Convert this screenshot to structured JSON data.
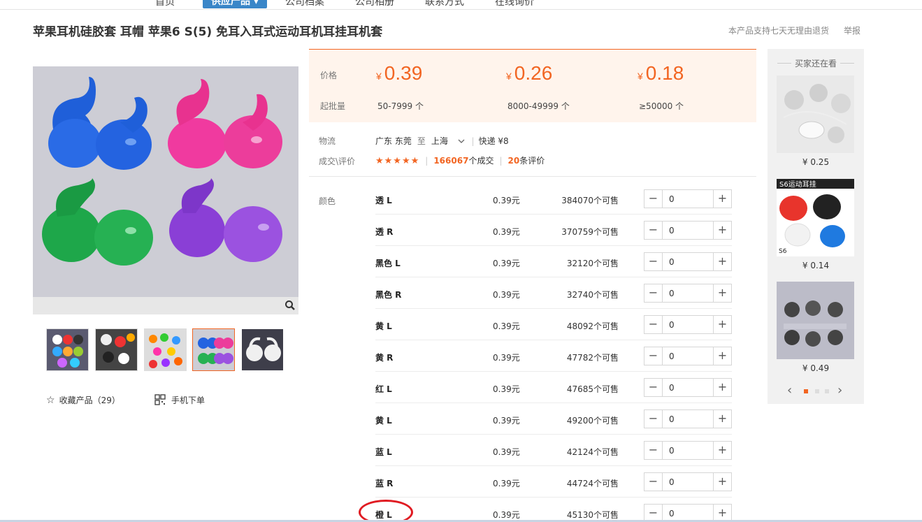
{
  "nav": {
    "items": [
      "首页",
      "供应产品 ▾",
      "公司档案",
      "公司相册",
      "联系方式",
      "在线询价"
    ]
  },
  "product": {
    "title": "苹果耳机硅胶套 耳帽 苹果6 S(5) 免耳入耳式运动耳机耳挂耳机套",
    "return_policy": "本产品支持七天无理由退货",
    "report": "举报"
  },
  "gallery": {
    "favorite_label": "收藏产品（29）",
    "mobile_label": "手机下单"
  },
  "pricing": {
    "price_label": "价格",
    "qty_label": "起批量",
    "currency": "¥",
    "tiers": [
      {
        "price": "0.39",
        "qty": "50-7999 个"
      },
      {
        "price": "0.26",
        "qty": "8000-49999 个"
      },
      {
        "price": "0.18",
        "qty": "≥50000 个"
      }
    ]
  },
  "logistics": {
    "label": "物流",
    "from": "广东 东莞",
    "to_word": "至",
    "to": "上海",
    "express": "快递 ¥8"
  },
  "deals": {
    "label": "成交\\评价",
    "stars": "★★★★★",
    "deal_count": "166067",
    "deal_suffix": "个成交",
    "review_count": "20",
    "review_suffix": "条评价"
  },
  "sku": {
    "label": "颜色",
    "rows": [
      {
        "name": "透 L",
        "price": "0.39元",
        "stock": "384070个可售",
        "qty": "0"
      },
      {
        "name": "透 R",
        "price": "0.39元",
        "stock": "370759个可售",
        "qty": "0"
      },
      {
        "name": "黑色 L",
        "price": "0.39元",
        "stock": "32120个可售",
        "qty": "0"
      },
      {
        "name": "黑色 R",
        "price": "0.39元",
        "stock": "32740个可售",
        "qty": "0"
      },
      {
        "name": "黄 L",
        "price": "0.39元",
        "stock": "48092个可售",
        "qty": "0"
      },
      {
        "name": "黄 R",
        "price": "0.39元",
        "stock": "47782个可售",
        "qty": "0"
      },
      {
        "name": "红 L",
        "price": "0.39元",
        "stock": "47685个可售",
        "qty": "0"
      },
      {
        "name": "黄 L",
        "price": "0.39元",
        "stock": "49200个可售",
        "qty": "0"
      },
      {
        "name": "蓝 L",
        "price": "0.39元",
        "stock": "42124个可售",
        "qty": "0"
      },
      {
        "name": "蓝 R",
        "price": "0.39元",
        "stock": "44724个可售",
        "qty": "0"
      },
      {
        "name": "橙 L",
        "price": "0.39元",
        "stock": "45130个可售",
        "qty": "0"
      }
    ]
  },
  "side": {
    "title": "买家还在看",
    "items": [
      {
        "price": "¥ 0.25"
      },
      {
        "price": "¥ 0.14",
        "image_text": "S6运动耳挂"
      },
      {
        "price": "¥ 0.49"
      }
    ]
  },
  "colors": {
    "accent": "#f26522",
    "highlight_circle": "#e01b22"
  }
}
